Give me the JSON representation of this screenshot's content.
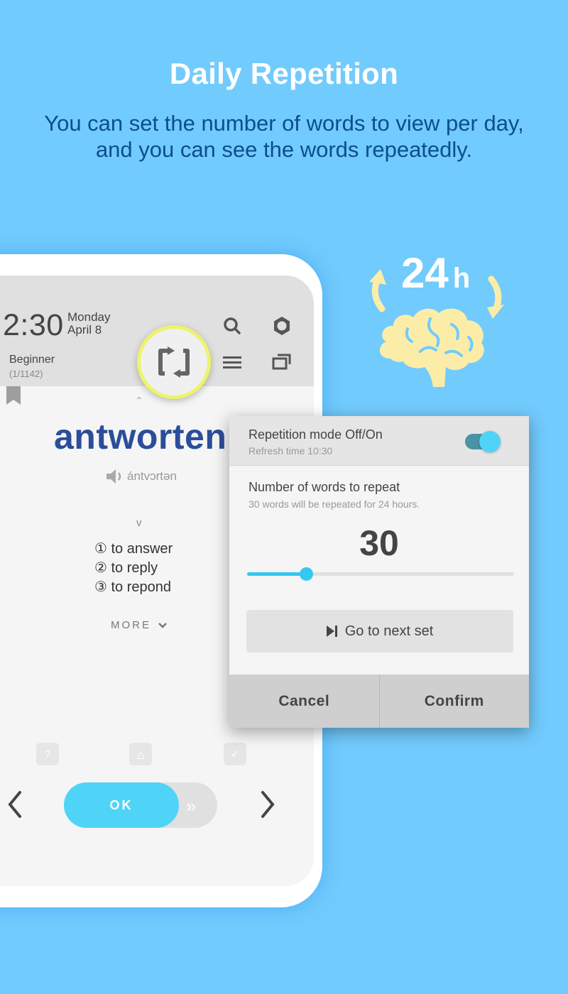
{
  "promo": {
    "title": "Daily Repetition",
    "subtitle_line1": "You can set the number of words to view per day,",
    "subtitle_line2": "and you can see the words repeatedly."
  },
  "illustration": {
    "hours_value": "24",
    "hours_unit": "h",
    "icon": "brain-icon"
  },
  "app": {
    "clock": "2:30",
    "day": "Monday",
    "date": "April 8",
    "level": "Beginner",
    "progress": "(1/1142)",
    "toolbar_icons": [
      "search-icon",
      "settings-icon",
      "repeat-icon",
      "menu-icon",
      "windows-icon"
    ],
    "card": {
      "word": "antworten",
      "pronunciation": "ántvɔrtən",
      "part_of_speech": "v",
      "meanings": [
        "① to answer",
        "② to reply",
        "③ to repond"
      ],
      "more_label": "MORE"
    },
    "rating_icons": [
      "?",
      "△",
      "✓"
    ],
    "ok_label": "OK",
    "colors": {
      "accent": "#4fd4f7",
      "word": "#2b4d9a",
      "highlight_ring": "#eef36b"
    }
  },
  "dialog": {
    "repetition_title": "Repetition mode Off/On",
    "refresh_time": "Refresh time 10:30",
    "repetition_enabled": true,
    "count_title": "Number of words to repeat",
    "count_subtitle": "30 words will be repeated for 24 hours.",
    "count_value": "30",
    "slider_fraction": 0.22,
    "next_set_label": "Go to next set",
    "cancel_label": "Cancel",
    "confirm_label": "Confirm"
  }
}
